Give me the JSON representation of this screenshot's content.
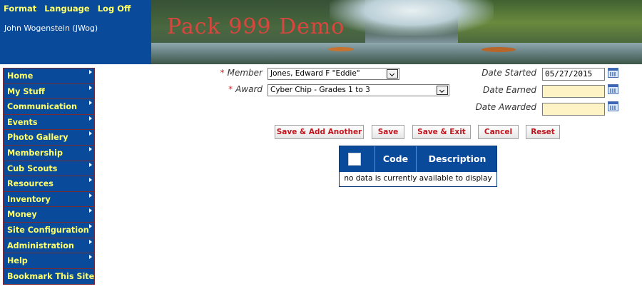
{
  "header": {
    "links": [
      "Format",
      "Language",
      "Log Off"
    ],
    "user": "John Wogenstein (JWog)",
    "banner_title": "Pack 999 Demo"
  },
  "sidebar": {
    "items": [
      {
        "label": "Home",
        "has_submenu": true
      },
      {
        "label": "My Stuff",
        "has_submenu": true
      },
      {
        "label": "Communication",
        "has_submenu": true
      },
      {
        "label": "Events",
        "has_submenu": true
      },
      {
        "label": "Photo Gallery",
        "has_submenu": true
      },
      {
        "label": "Membership",
        "has_submenu": true
      },
      {
        "label": "Cub Scouts",
        "has_submenu": true
      },
      {
        "label": "Resources",
        "has_submenu": true
      },
      {
        "label": "Inventory",
        "has_submenu": true
      },
      {
        "label": "Money",
        "has_submenu": true
      },
      {
        "label": "Site Configuration",
        "has_submenu": true
      },
      {
        "label": "Administration",
        "has_submenu": true
      },
      {
        "label": "Help",
        "has_submenu": true
      },
      {
        "label": "Bookmark This Site",
        "has_submenu": false
      }
    ]
  },
  "form": {
    "required_marker": "*",
    "member_label": "Member",
    "member_value": "Jones, Edward F \"Eddie\"",
    "award_label": "Award",
    "award_value": "Cyber Chip - Grades 1 to 3",
    "date_started_label": "Date Started",
    "date_started_value": "05/27/2015",
    "date_earned_label": "Date Earned",
    "date_earned_value": "",
    "date_awarded_label": "Date Awarded",
    "date_awarded_value": ""
  },
  "buttons": {
    "save_add": "Save & Add Another",
    "save": "Save",
    "save_exit": "Save & Exit",
    "cancel": "Cancel",
    "reset": "Reset"
  },
  "grid": {
    "columns": [
      "Code",
      "Description"
    ],
    "empty_message": "no data is currently available to display"
  },
  "colors": {
    "nav_bg": "#0a4a9a",
    "nav_text": "#ffff66",
    "button_text": "#c0151d",
    "required": "#e02020",
    "empty_date_bg": "#fdf3c4"
  }
}
